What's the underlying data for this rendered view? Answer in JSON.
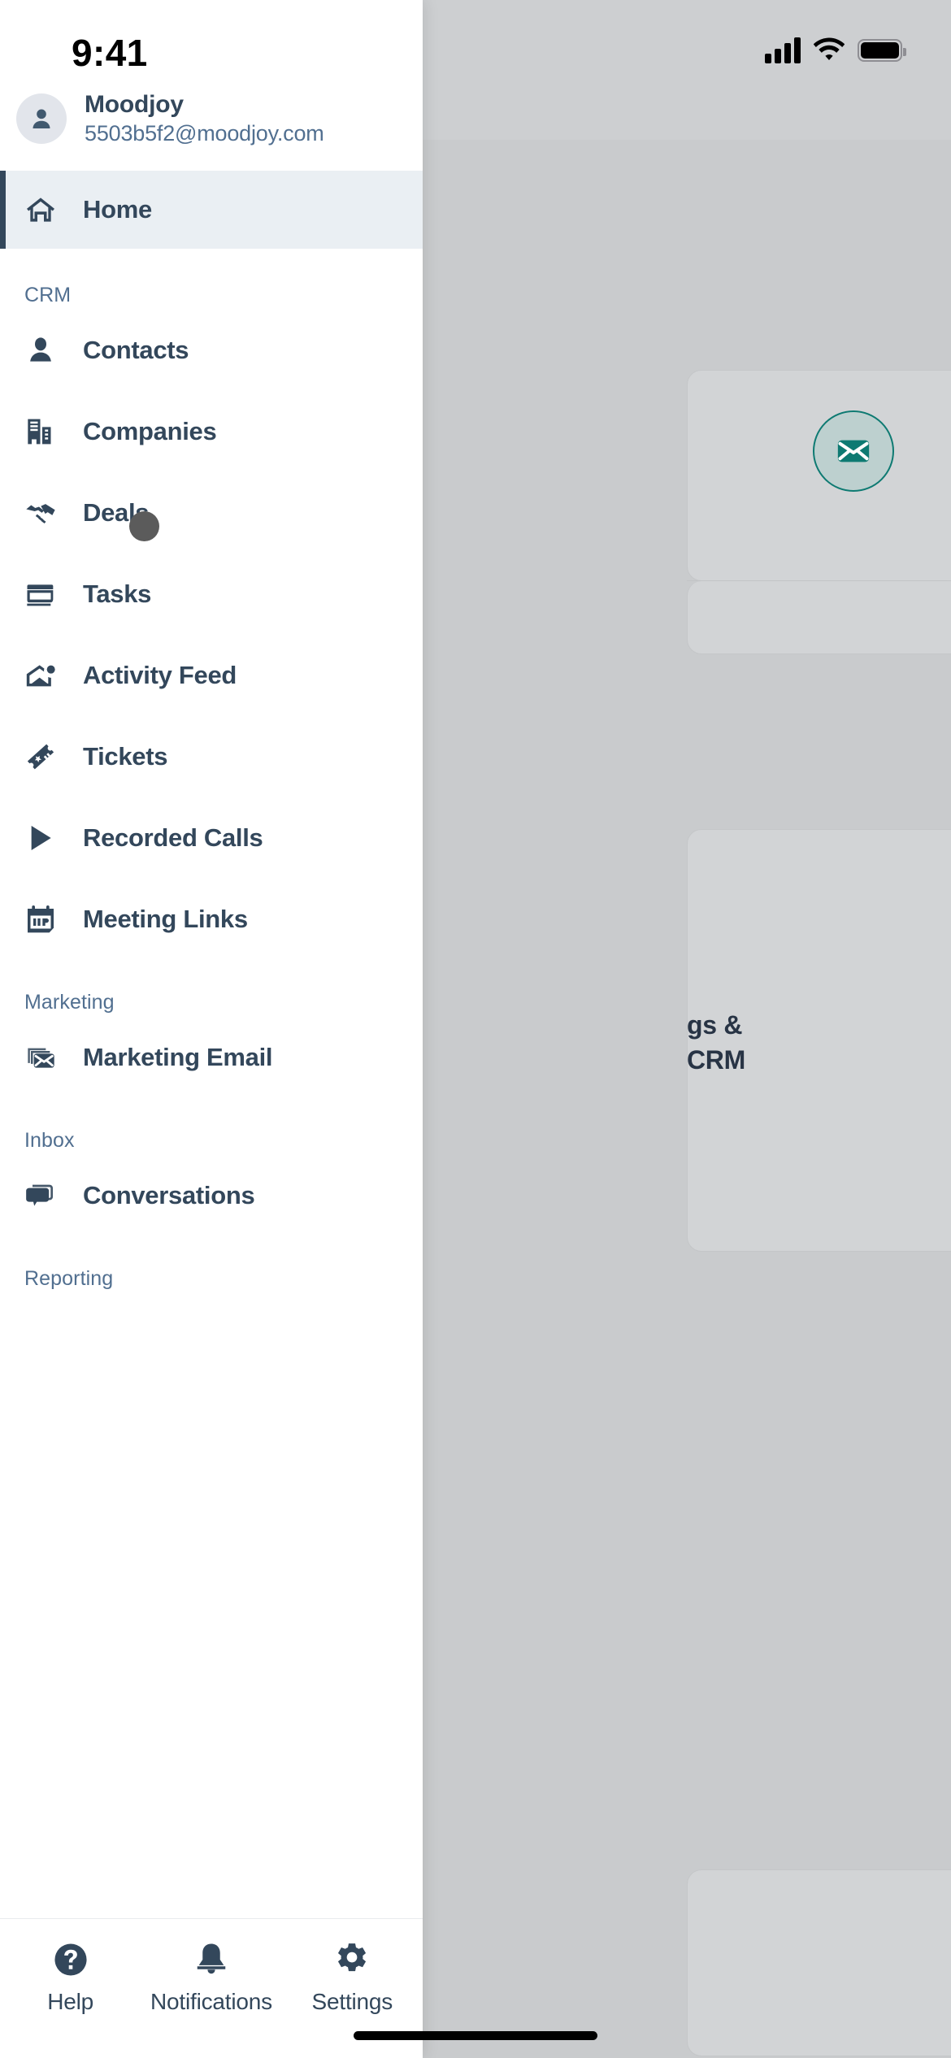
{
  "status_bar": {
    "time": "9:41",
    "signal_icon": "cellular-signal-icon",
    "wifi_icon": "wifi-icon",
    "battery_icon": "battery-icon"
  },
  "drawer": {
    "profile": {
      "avatar_icon": "user-avatar-icon",
      "name": "Moodjoy",
      "email": "5503b5f2@moodjoy.com"
    },
    "primary_item": {
      "label": "Home",
      "icon": "home-icon",
      "active": true
    },
    "sections": [
      {
        "title": "CRM",
        "items": [
          {
            "label": "Contacts",
            "icon": "contact-person-icon"
          },
          {
            "label": "Companies",
            "icon": "companies-building-icon"
          },
          {
            "label": "Deals",
            "icon": "handshake-icon"
          },
          {
            "label": "Tasks",
            "icon": "tasks-notepad-icon"
          },
          {
            "label": "Activity Feed",
            "icon": "activity-feed-icon"
          },
          {
            "label": "Tickets",
            "icon": "ticket-icon"
          },
          {
            "label": "Recorded Calls",
            "icon": "play-triangle-icon"
          },
          {
            "label": "Meeting Links",
            "icon": "calendar-icon"
          }
        ]
      },
      {
        "title": "Marketing",
        "items": [
          {
            "label": "Marketing Email",
            "icon": "stacked-envelope-icon"
          }
        ]
      },
      {
        "title": "Inbox",
        "items": [
          {
            "label": "Conversations",
            "icon": "chat-bubble-icon"
          }
        ]
      },
      {
        "title": "Reporting",
        "items": []
      }
    ]
  },
  "bottom_bar": {
    "items": [
      {
        "label": "Help",
        "icon": "help-question-circle-icon"
      },
      {
        "label": "Notifications",
        "icon": "bell-icon"
      },
      {
        "label": "Settings",
        "icon": "gear-icon"
      }
    ]
  },
  "background_page": {
    "mail_button_icon": "envelope-icon",
    "text_line_1": "gs &",
    "text_line_2": "CRM"
  },
  "colors": {
    "brand_navy": "#33475b",
    "muted_slate": "#516f90",
    "active_row_bg": "#eaeff3",
    "teal_accent": "#0e7a72",
    "scrim": "#c9cbcd"
  }
}
